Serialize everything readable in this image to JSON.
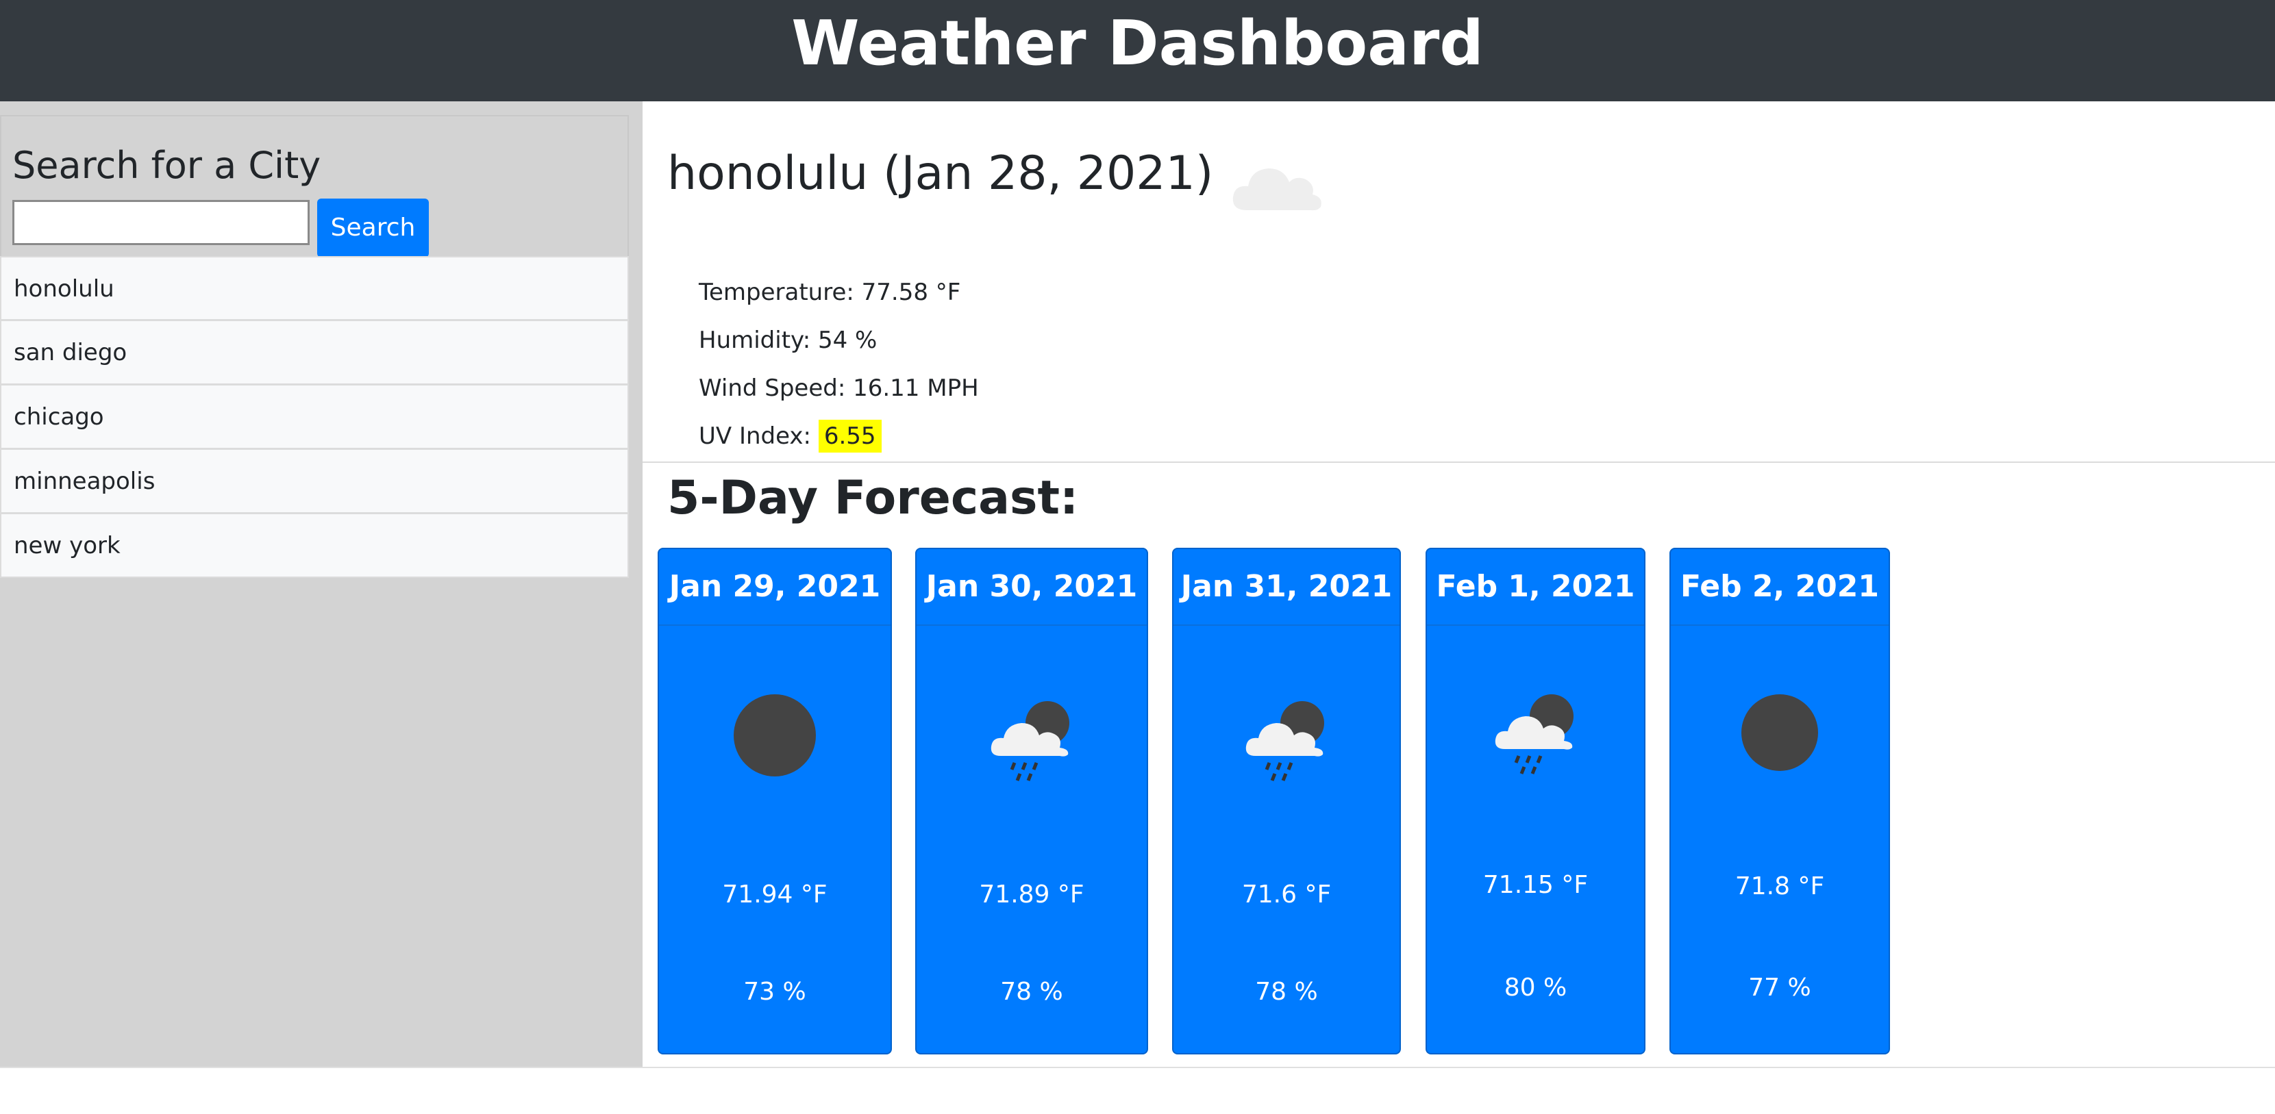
{
  "header": {
    "title": "Weather Dashboard"
  },
  "sidebar": {
    "search_heading": "Search for a City",
    "search_input_value": "",
    "search_button_label": "Search",
    "cities": [
      "honolulu",
      "san diego",
      "chicago",
      "minneapolis",
      "new york"
    ]
  },
  "current": {
    "title": "honolulu (Jan 28, 2021)",
    "icon": "cloud-icon",
    "temperature": "Temperature: 77.58 °F",
    "humidity": "Humidity: 54 %",
    "wind": "Wind Speed: 16.11 MPH",
    "uv_label": "UV Index: ",
    "uv_value": "6.55",
    "uv_color": "#ffff00"
  },
  "forecast": {
    "heading": "5-Day Forecast:",
    "days": [
      {
        "date": "Jan 29, 2021",
        "icon": "night-clear-icon",
        "temp": "71.94 °F",
        "humidity": "73 %"
      },
      {
        "date": "Jan 30, 2021",
        "icon": "night-rain-icon",
        "temp": "71.89 °F",
        "humidity": "78 %"
      },
      {
        "date": "Jan 31, 2021",
        "icon": "night-rain-icon",
        "temp": "71.6 °F",
        "humidity": "78 %"
      },
      {
        "date": "Feb 1, 2021",
        "icon": "night-rain-icon",
        "temp": "71.15 °F",
        "humidity": "80 %"
      },
      {
        "date": "Feb 2, 2021",
        "icon": "night-clear-icon",
        "temp": "71.8 °F",
        "humidity": "77 %"
      }
    ]
  },
  "colors": {
    "header_bg": "#343a40",
    "sidebar_bg": "#d3d3d3",
    "accent": "#007bff",
    "uv_highlight": "#ffff00"
  }
}
